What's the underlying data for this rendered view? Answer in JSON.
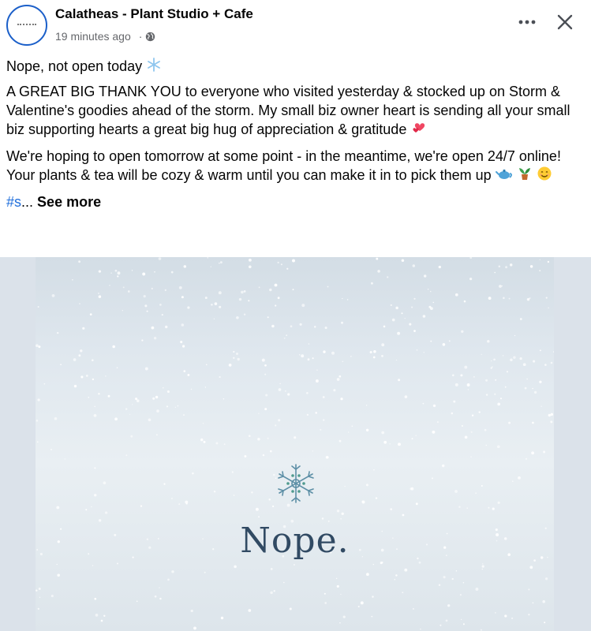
{
  "post": {
    "page_name": "Calatheas - Plant Studio + Cafe",
    "timestamp": "19 minutes ago",
    "separator": "·",
    "privacy_icon": "globe-icon",
    "more_icon": "more-horizontal-icon",
    "close_icon": "close-icon"
  },
  "content": {
    "line1": "Nope, not open today",
    "para2": "A GREAT BIG THANK YOU to everyone who visited yesterday & stocked up on Storm & Valentine's goodies ahead of the storm. My small biz owner heart is sending all your small biz supporting hearts a great big hug of appreciation & gratitude",
    "para3": "We're hoping to open tomorrow at some point - in the meantime, we're open 24/7 online! Your plants & tea will be cozy & warm until you can make it in to pick them up",
    "hashtag": "#s",
    "ellipsis": "...",
    "see_more": "See more"
  },
  "media": {
    "image_text": "Nope.",
    "icon": "snowflake-icon"
  },
  "colors": {
    "link": "#216fdb",
    "meta": "#65676b",
    "image_text": "#314a63",
    "accent": "#1b5fc9"
  }
}
